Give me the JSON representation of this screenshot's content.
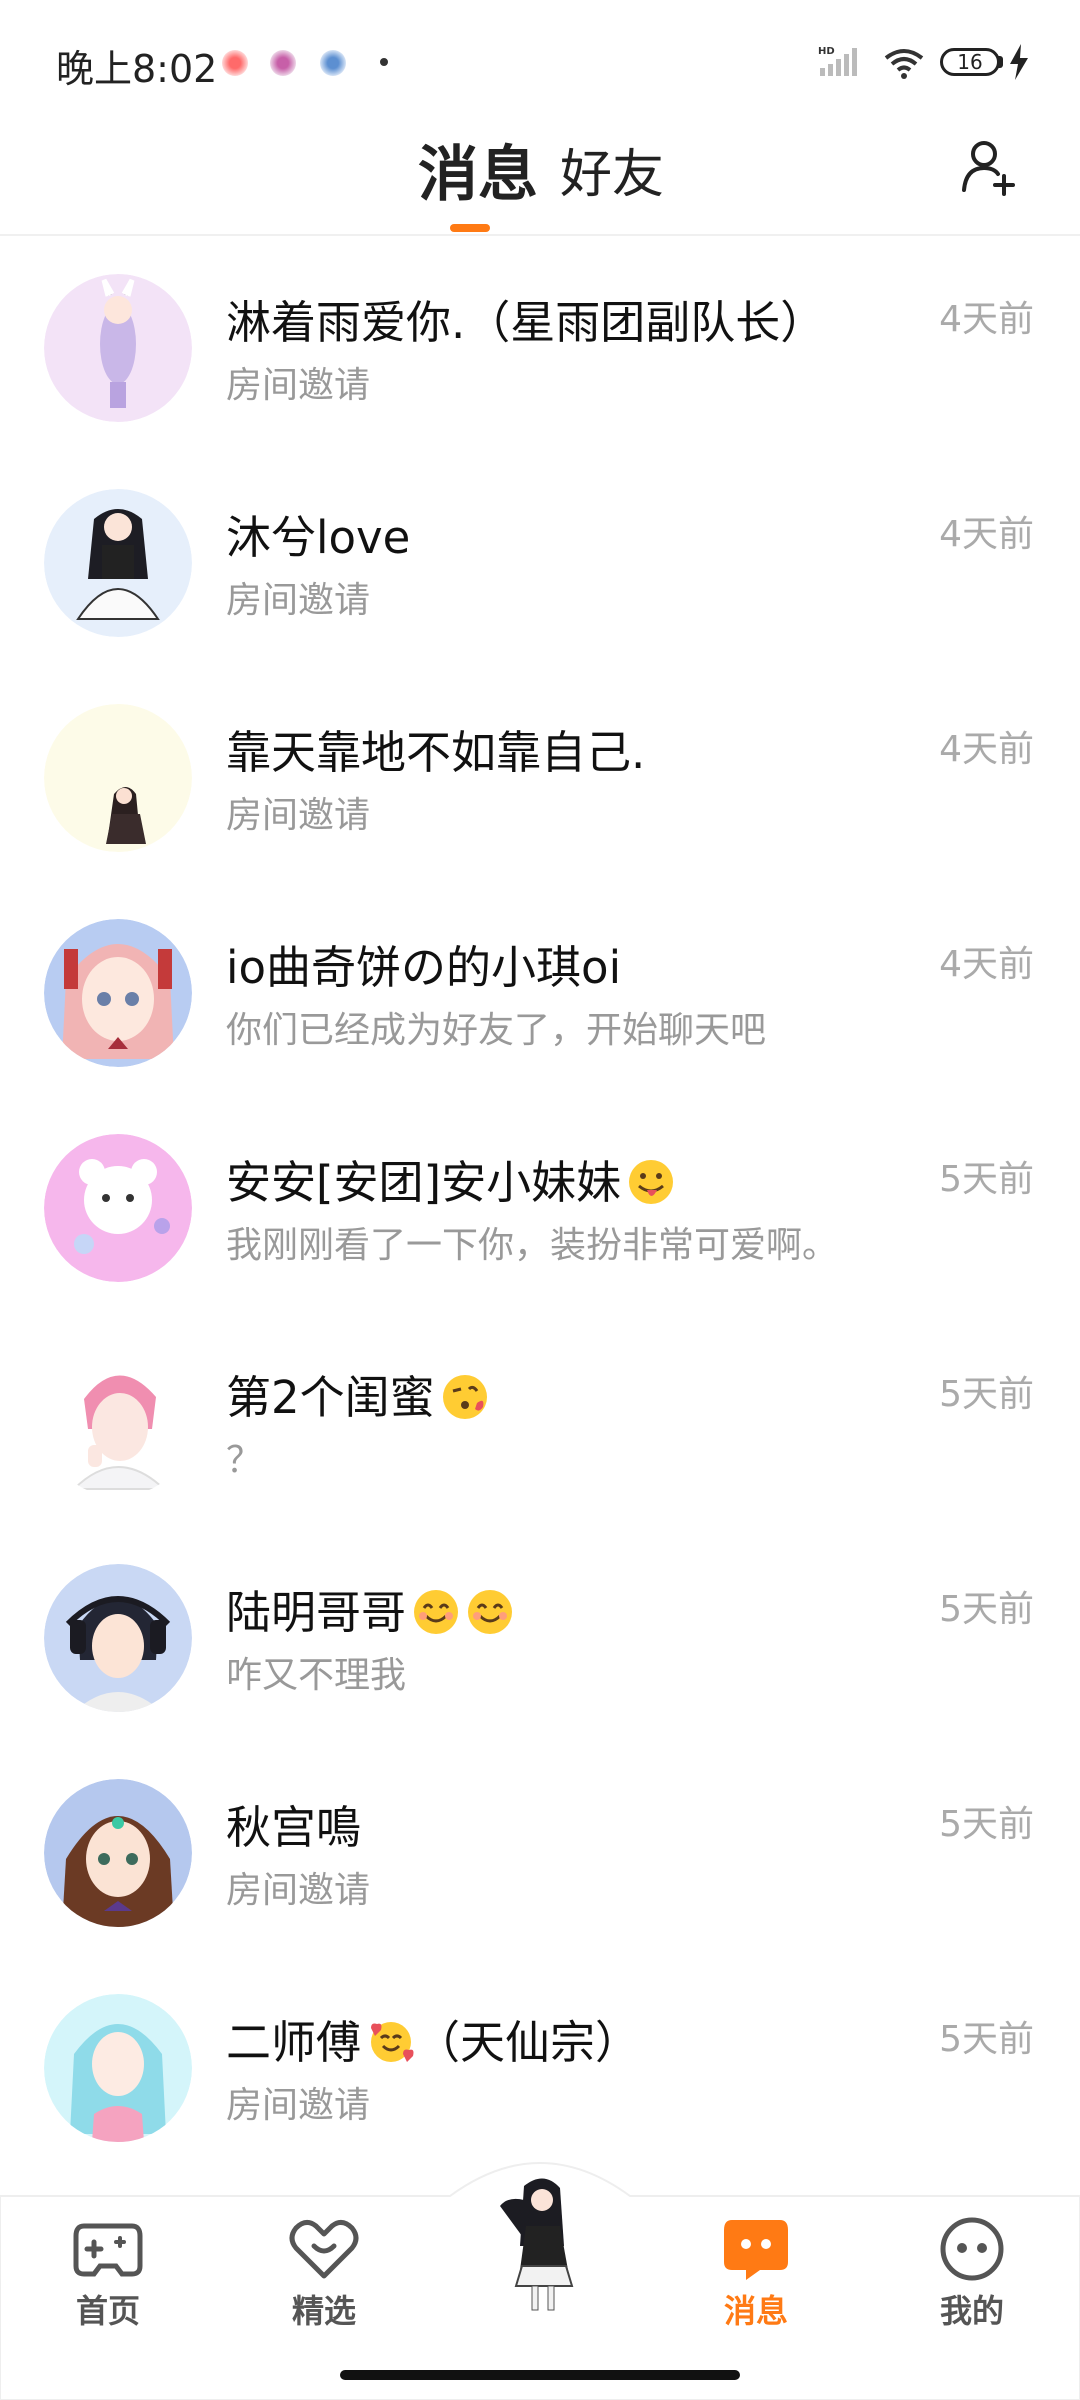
{
  "status_bar": {
    "time": "晚上8:02",
    "network_badge": "HD",
    "battery_level": "16"
  },
  "header": {
    "tab_messages": "消息",
    "tab_friends": "好友",
    "active_tab": "消息",
    "add_friend_icon": "add-person-icon"
  },
  "colors": {
    "accent": "#ff7a14",
    "preview_text": "#999999",
    "timestamp_text": "#aaaaaa"
  },
  "conversations": [
    {
      "name": "淋着雨爱你.（星雨团副队长）",
      "preview": "房间邀请",
      "time": "4天前"
    },
    {
      "name": "沐兮love",
      "preview": "房间邀请",
      "time": "4天前"
    },
    {
      "name": "靠天靠地不如靠自己.",
      "preview": "房间邀请",
      "time": "4天前"
    },
    {
      "name": "io曲奇饼の的小琪oi",
      "preview": "你们已经成为好友了，开始聊天吧",
      "time": "4天前"
    },
    {
      "name": "安安[安团]安小妹妹",
      "preview": "我刚刚看了一下你，装扮非常可爱啊。",
      "time": "5天前"
    },
    {
      "name": "第2个闺蜜",
      "preview": "？",
      "time": "5天前"
    },
    {
      "name": "陆明哥哥",
      "preview": "咋又不理我",
      "time": "5天前"
    },
    {
      "name": "秋宫鳴",
      "preview": "房间邀请",
      "time": "5天前"
    },
    {
      "name": "二师傅",
      "name_suffix": "（天仙宗）",
      "preview": "房间邀请",
      "time": "5天前"
    }
  ],
  "bottom_nav": {
    "home": "首页",
    "featured": "精选",
    "messages": "消息",
    "mine": "我的",
    "active": "消息"
  }
}
